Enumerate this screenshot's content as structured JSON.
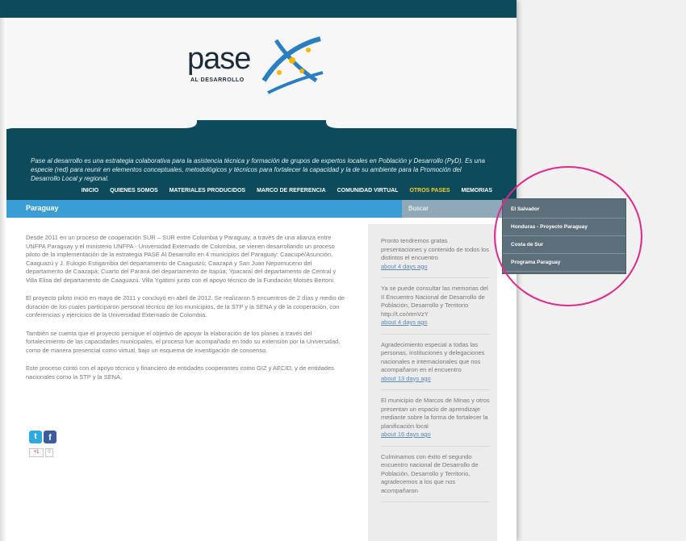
{
  "header": {
    "logo_word": "pase",
    "logo_subtitle": "AL DESARROLLO",
    "tagline": "Pase al desarrollo es una estrategia colaborativa para la asistencia técnica y formación de grupos de expertos locales en Población y Desarrollo (PyD). Es una especie (red) para reunir en elementos conceptuales, metodológicos y técnicos para fortalecer la capacidad y la de su ambiente para la Promoción del Desarrollo Local y regional."
  },
  "nav": {
    "items": [
      "INICIO",
      "QUIENES SOMOS",
      "MATERIALES PRODUCIDOS",
      "MARCO DE REFERENCIA",
      "COMUNIDAD VIRTUAL",
      "OTROS PASES",
      "MEMORIAS"
    ],
    "active_index": 5
  },
  "breadcrumb": {
    "label": "Paraguay"
  },
  "search": {
    "label": "Buscar"
  },
  "dropdown": {
    "items": [
      "El Salvador",
      "Honduras - Proyecto Paraguay",
      "Costa de Sur",
      "Programa Paraguay"
    ]
  },
  "main": {
    "paragraphs": [
      "Desde 2011 en un proceso de cooperación SUR – SUR entre Colombia y Paraguay, a través de una alianza entre UNFPA Paraguay y el ministerio UNFPA - Universidad Externado de Colombia, se vienen desarrollando un proceso piloto de la implementación de la estrategia PASE Al Desarrollo en 4 municipios del Paraguay: Caacupé/Asunción, Caaguazú y J. Eulogio Estigarribia del departamento de Caaguazú; Caazapá y San Juan Nepomuceno del departamento de Caazapá; Cuarto del Paraná del departamento de Itapúa; Ypacaraí del departamento de Central y Villa Elisa del departamento de Caaguazú. Villa Ygatimí junto con el apoyo técnico de la Fundación Moisés Bertoni.",
      "El proyecto piloto inició en mayo de 2011 y concluyó en abril de 2012. Se realizaron 5 encuentros de 2 días y medio de duración de los cuales participaron personal técnico de los municipios, de la STP y la SENA y de la cooperación, con conferencias y ejercicios de la Universidad Externado de Colombia.",
      "También se cuenta que el proyecto persigue el objetivo de apoyar la elaboración de los planes a través del fortalecimiento de las capacidades municipales, el proceso fue acompañado en todo su extensión por la Universidad, como de manera presencial como virtual, bajo un esquema de investigación de consenso.",
      "Este proceso contó con el apoyo técnico y financiero de entidades cooperantes como GIZ y AECID, y de entidades nacionales como la STP y la SENA."
    ]
  },
  "social": {
    "twitter": "t",
    "facebook": "f",
    "gplus": "+1",
    "gcount": "0"
  },
  "sidebar": {
    "tweets": [
      {
        "text": "Pronto tendremos gratas presentaciones y contenido de todos los distintos el encuentro",
        "link": "about 4 days ago"
      },
      {
        "text": "Ya se puede consultar las memorias del II Encuentro Nacional de Desarrollo de Población, Desarrollo y Territorio http://t.co/xtmVzY",
        "link": "about 4 days ago"
      },
      {
        "text": "Agradecimiento especial a todas las personas, instituciones y delegaciones nacionales e internacionales que nos acompañaron en el encuentro",
        "link": "about 13 days ago"
      },
      {
        "text": "El municipio de Marcos de Minas y otros presentan un espacio de aprendizaje mediante sobre la forma de fortalecer la planificación local",
        "link": "about 16 days ago"
      },
      {
        "text": "Culminamos con éxito el segundo encuentro nacional de Desarrollo de Población, Desarrollo y Territorio, agradecemos a los que nos acompañaron",
        "link": ""
      }
    ]
  },
  "colors": {
    "banner": "#0c4a5c",
    "bluebar": "#3b9dd6",
    "active_nav": "#f6d321",
    "dropdown": "#5d6f7a",
    "highlight_circle": "#e0288a"
  }
}
